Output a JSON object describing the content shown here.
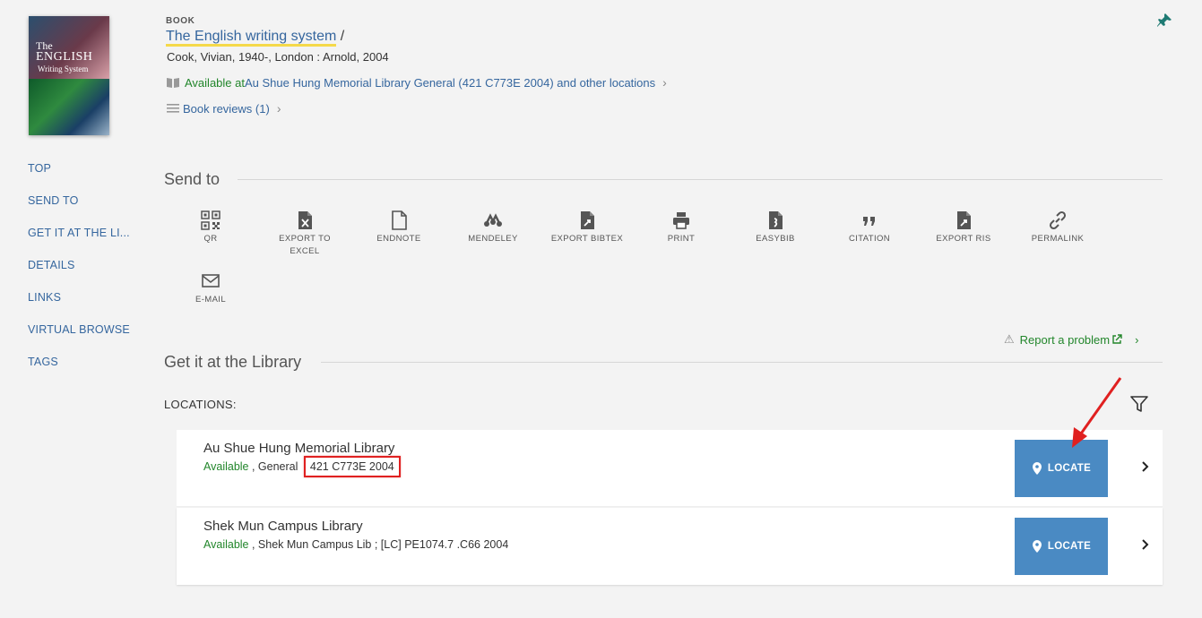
{
  "cover": {
    "title_line1": "The",
    "title_line2": "ENGLISH",
    "title_line3": "Writing System"
  },
  "leftnav": {
    "items": [
      "TOP",
      "SEND TO",
      "GET IT AT THE LI...",
      "DETAILS",
      "LINKS",
      "VIRTUAL BROWSE",
      "TAGS"
    ]
  },
  "record": {
    "type": "BOOK",
    "title": "The English writing system",
    "title_suffix": " /",
    "subtitle": "Cook, Vivian, 1940-, London : Arnold, 2004",
    "availability_status": "Available at ",
    "availability_location": "Au Shue Hung Memorial Library  General (421 C773E 2004) and other locations",
    "reviews_label": "Book reviews (1)"
  },
  "send_to": {
    "title": "Send to",
    "items": [
      {
        "label": "QR",
        "icon": "qr-icon"
      },
      {
        "label": "EXPORT TO",
        "label2": "EXCEL",
        "icon": "excel-icon"
      },
      {
        "label": "ENDNOTE",
        "icon": "endnote-icon"
      },
      {
        "label": "MENDELEY",
        "icon": "mendeley-icon"
      },
      {
        "label": "EXPORT BIBTEX",
        "icon": "bibtex-icon"
      },
      {
        "label": "PRINT",
        "icon": "print-icon"
      },
      {
        "label": "EASYBIB",
        "icon": "easybib-icon"
      },
      {
        "label": "CITATION",
        "icon": "quote-icon"
      },
      {
        "label": "EXPORT RIS",
        "icon": "ris-icon"
      },
      {
        "label": "PERMALINK",
        "icon": "link-icon"
      },
      {
        "label": "E-MAIL",
        "icon": "mail-icon"
      }
    ]
  },
  "report": {
    "label": "Report a problem"
  },
  "get_it": {
    "title": "Get it at the Library",
    "locations_label": "LOCATIONS:",
    "locations": [
      {
        "name": "Au Shue Hung Memorial Library",
        "status": "Available",
        "detail": " , General ",
        "call_number": "421 C773E 2004",
        "button": "LOCATE"
      },
      {
        "name": "Shek Mun Campus Library",
        "status": "Available",
        "detail": " , Shek Mun Campus Lib ; [LC] PE1074.7 .C66 2004",
        "call_number": "",
        "button": "LOCATE"
      }
    ]
  },
  "colors": {
    "link": "#35669e",
    "available": "#22862b",
    "button": "#4a8ac3",
    "highlight": "#f5d94a",
    "annotation": "#e02020"
  }
}
